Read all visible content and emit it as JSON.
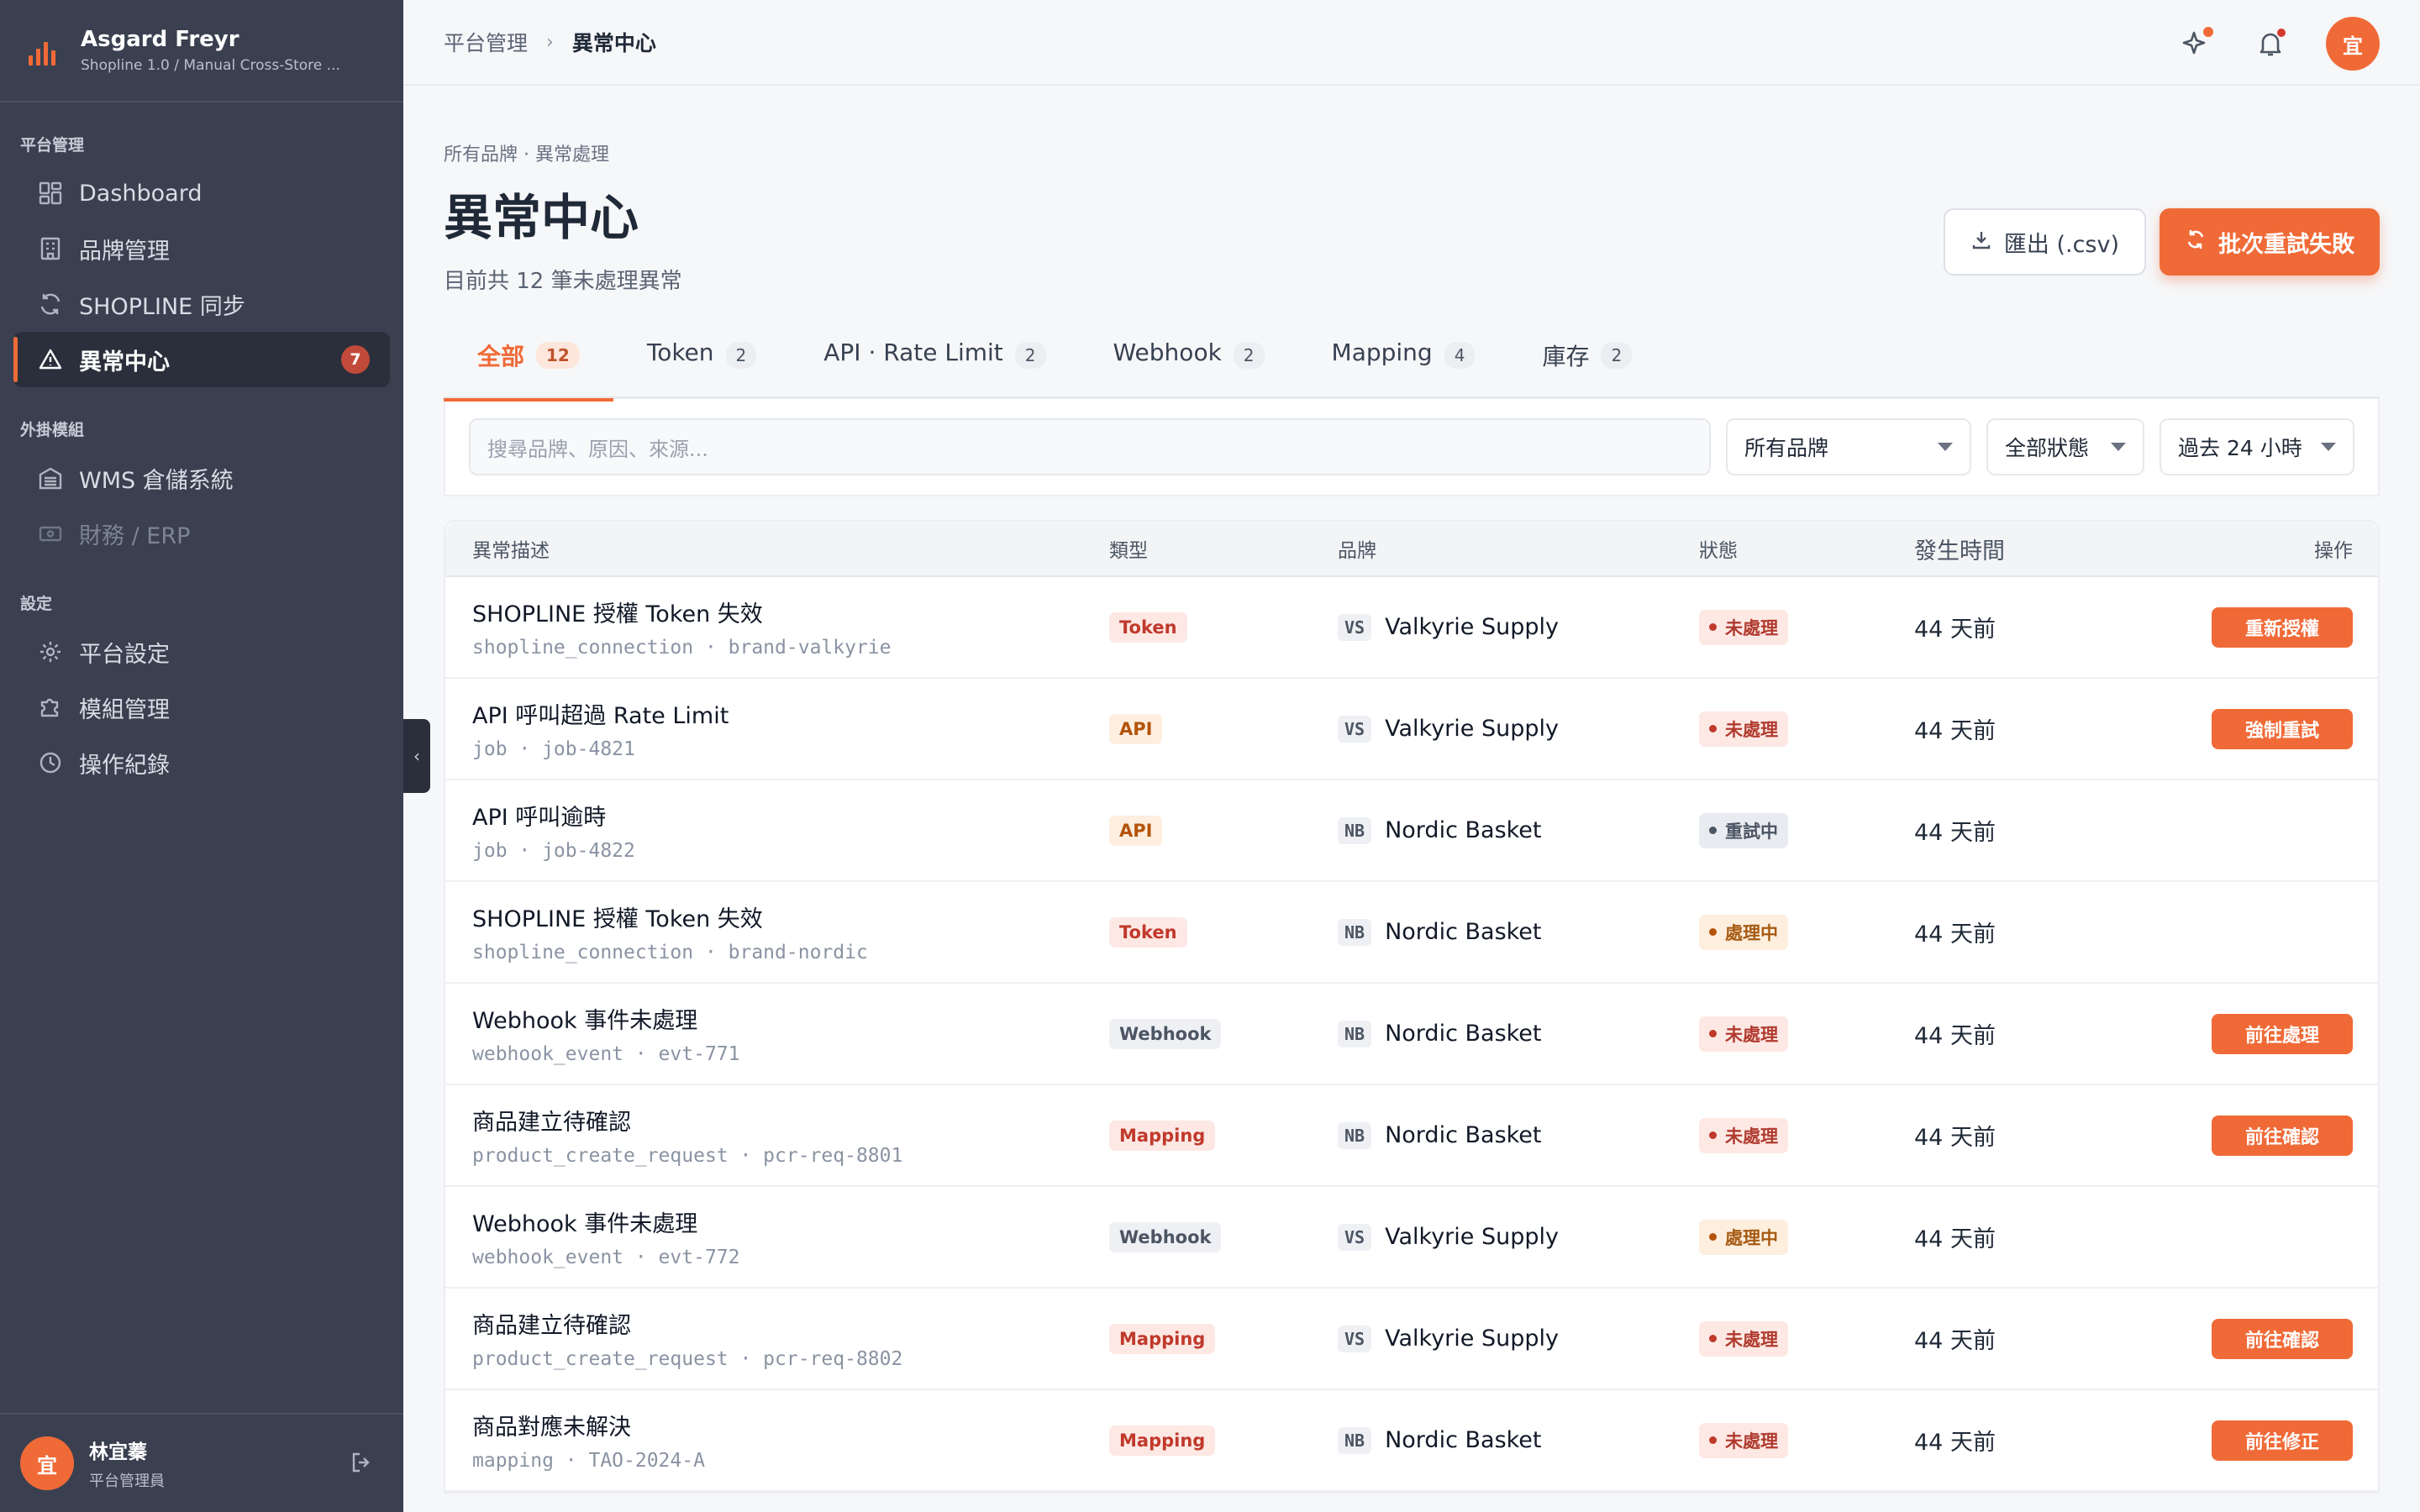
{
  "app": {
    "name": "Asgard Freyr",
    "subtitle": "Shopline 1.0 / Manual Cross-Store ..."
  },
  "sidebar": {
    "sections": [
      {
        "label": "平台管理",
        "items": [
          {
            "label": "Dashboard",
            "icon": "dashboard-icon"
          },
          {
            "label": "品牌管理",
            "icon": "building-icon"
          },
          {
            "label": "SHOPLINE 同步",
            "icon": "sync-icon"
          },
          {
            "label": "異常中心",
            "icon": "warning-icon",
            "badge": "7",
            "active": true
          }
        ]
      },
      {
        "label": "外掛模組",
        "items": [
          {
            "label": "WMS 倉儲系統",
            "icon": "warehouse-icon"
          },
          {
            "label": "財務 / ERP",
            "icon": "finance-icon",
            "disabled": true
          }
        ]
      },
      {
        "label": "設定",
        "items": [
          {
            "label": "平台設定",
            "icon": "gear-icon"
          },
          {
            "label": "模組管理",
            "icon": "puzzle-icon"
          },
          {
            "label": "操作紀錄",
            "icon": "clock-icon"
          }
        ]
      }
    ],
    "user": {
      "avatar": "宜",
      "name": "林宜蓁",
      "role": "平台管理員"
    }
  },
  "header": {
    "breadcrumb": [
      "平台管理",
      "異常中心"
    ],
    "avatar": "宜"
  },
  "page": {
    "sub_crumb": "所有品牌 · 異常處理",
    "title": "異常中心",
    "desc": "目前共 12 筆未處理異常",
    "export_label": "匯出 (.csv)",
    "retry_label": "批次重試失敗"
  },
  "tabs": [
    {
      "label": "全部",
      "count": "12",
      "active": true
    },
    {
      "label": "Token",
      "count": "2"
    },
    {
      "label": "API · Rate Limit",
      "count": "2"
    },
    {
      "label": "Webhook",
      "count": "2"
    },
    {
      "label": "Mapping",
      "count": "4"
    },
    {
      "label": "庫存",
      "count": "2"
    }
  ],
  "filters": {
    "search_placeholder": "搜尋品牌、原因、來源...",
    "brand": "所有品牌",
    "status": "全部狀態",
    "period": "過去 24 小時"
  },
  "table": {
    "headers": [
      "異常描述",
      "類型",
      "品牌",
      "狀態",
      "發生時間",
      "操作"
    ],
    "rows": [
      {
        "title": "SHOPLINE 授權 Token 失效",
        "sub": "shopline_connection · brand-valkyrie",
        "type": "Token",
        "type_class": "token",
        "brand_tag": "VS",
        "brand": "Valkyrie Supply",
        "status": "未處理",
        "status_class": "open",
        "time": "44 天前",
        "action": "重新授權"
      },
      {
        "title": "API 呼叫超過 Rate Limit",
        "sub": "job · job-4821",
        "type": "API",
        "type_class": "api",
        "brand_tag": "VS",
        "brand": "Valkyrie Supply",
        "status": "未處理",
        "status_class": "open",
        "time": "44 天前",
        "action": "強制重試"
      },
      {
        "title": "API 呼叫逾時",
        "sub": "job · job-4822",
        "type": "API",
        "type_class": "api",
        "brand_tag": "NB",
        "brand": "Nordic Basket",
        "status": "重試中",
        "status_class": "retry",
        "time": "44 天前",
        "action": ""
      },
      {
        "title": "SHOPLINE 授權 Token 失效",
        "sub": "shopline_connection · brand-nordic",
        "type": "Token",
        "type_class": "token",
        "brand_tag": "NB",
        "brand": "Nordic Basket",
        "status": "處理中",
        "status_class": "progress",
        "time": "44 天前",
        "action": ""
      },
      {
        "title": "Webhook 事件未處理",
        "sub": "webhook_event · evt-771",
        "type": "Webhook",
        "type_class": "webhook",
        "brand_tag": "NB",
        "brand": "Nordic Basket",
        "status": "未處理",
        "status_class": "open",
        "time": "44 天前",
        "action": "前往處理"
      },
      {
        "title": "商品建立待確認",
        "sub": "product_create_request · pcr-req-8801",
        "type": "Mapping",
        "type_class": "mapping",
        "brand_tag": "NB",
        "brand": "Nordic Basket",
        "status": "未處理",
        "status_class": "open",
        "time": "44 天前",
        "action": "前往確認"
      },
      {
        "title": "Webhook 事件未處理",
        "sub": "webhook_event · evt-772",
        "type": "Webhook",
        "type_class": "webhook",
        "brand_tag": "VS",
        "brand": "Valkyrie Supply",
        "status": "處理中",
        "status_class": "progress",
        "time": "44 天前",
        "action": ""
      },
      {
        "title": "商品建立待確認",
        "sub": "product_create_request · pcr-req-8802",
        "type": "Mapping",
        "type_class": "mapping",
        "brand_tag": "VS",
        "brand": "Valkyrie Supply",
        "status": "未處理",
        "status_class": "open",
        "time": "44 天前",
        "action": "前往確認"
      },
      {
        "title": "商品對應未解決",
        "sub": "mapping · TAO-2024-A",
        "type": "Mapping",
        "type_class": "mapping",
        "brand_tag": "NB",
        "brand": "Nordic Basket",
        "status": "未處理",
        "status_class": "open",
        "time": "44 天前",
        "action": "前往修正"
      }
    ]
  },
  "colors": {
    "accent": "#f06a37",
    "sidebar": "#3a4050",
    "danger": "#c0392b"
  }
}
